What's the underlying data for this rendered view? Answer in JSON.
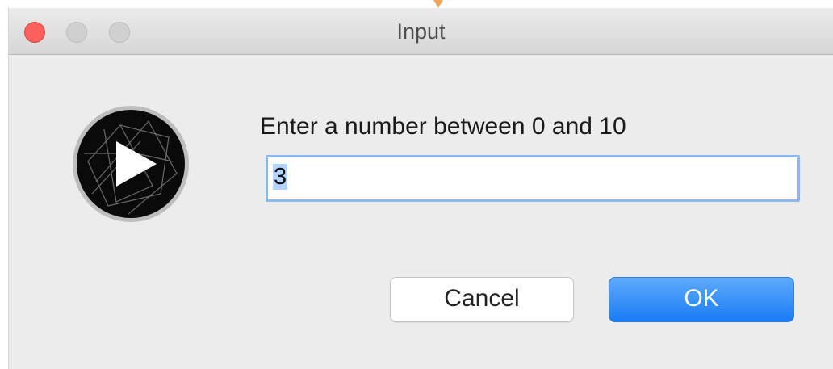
{
  "window": {
    "title": "Input"
  },
  "dialog": {
    "prompt": "Enter a number between 0 and 10",
    "input_value": "3",
    "cancel_label": "Cancel",
    "ok_label": "OK"
  },
  "icons": {
    "app_icon": "play-logo-icon",
    "traffic_lights": [
      "close-icon",
      "minimize-icon",
      "zoom-icon"
    ]
  },
  "colors": {
    "accent": "#1a7cf4",
    "close": "#fc605c",
    "focus_ring": "#8cb7ee"
  }
}
